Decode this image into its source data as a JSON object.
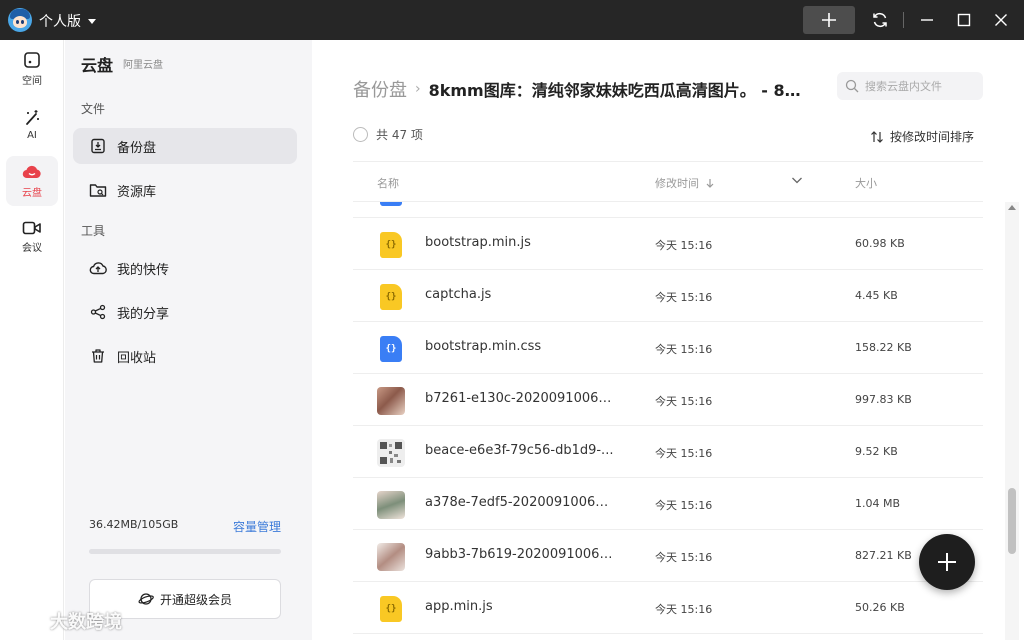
{
  "titlebar": {
    "edition_label": "个人版",
    "icons": [
      "avatar",
      "chevron-down-icon",
      "plus-icon",
      "sync-icon",
      "minimize-icon",
      "maximize-icon",
      "close-icon"
    ]
  },
  "rail": {
    "items": [
      {
        "label": "空间",
        "icon": "space-icon"
      },
      {
        "label": "AI",
        "icon": "magic-wand-icon"
      },
      {
        "label": "云盘",
        "icon": "cloud-icon"
      },
      {
        "label": "会议",
        "icon": "video-icon"
      }
    ]
  },
  "panel": {
    "title": "云盘",
    "subtitle": "阿里云盘",
    "section_files": "文件",
    "section_tools": "工具",
    "file_items": [
      {
        "label": "备份盘",
        "icon": "backup-drive-icon"
      },
      {
        "label": "资源库",
        "icon": "resource-folder-icon"
      }
    ],
    "tool_items": [
      {
        "label": "我的快传",
        "icon": "cloud-upload-icon"
      },
      {
        "label": "我的分享",
        "icon": "share-icon"
      },
      {
        "label": "回收站",
        "icon": "trash-icon"
      }
    ],
    "storage_text": "36.42MB/105GB",
    "storage_used_fraction": 0.0003,
    "storage_link": "容量管理",
    "vip_label": "开通超级会员"
  },
  "main": {
    "breadcrumb_root": "备份盘",
    "breadcrumb_current": "8kmm图库：清纯邻家妹妹吃西瓜高清图片。 - 8kmm...",
    "search_placeholder": "搜索云盘内文件",
    "count_text": "共 47 项",
    "sort_label": "按修改时间排序",
    "col_name": "名称",
    "col_time": "修改时间",
    "col_size": "大小",
    "files": [
      {
        "name": "bootstrap.min.js",
        "time": "今天 15:16",
        "size": "60.98 KB",
        "type": "js"
      },
      {
        "name": "captcha.js",
        "time": "今天 15:16",
        "size": "4.45 KB",
        "type": "js"
      },
      {
        "name": "bootstrap.min.css",
        "time": "今天 15:16",
        "size": "158.22 KB",
        "type": "css"
      },
      {
        "name": "b7261-e130c-20200910061...",
        "time": "今天 15:16",
        "size": "997.83 KB",
        "type": "photo"
      },
      {
        "name": "beace-e6e3f-79c56-db1d9-...",
        "time": "今天 15:16",
        "size": "9.52 KB",
        "type": "qr"
      },
      {
        "name": "a378e-7edf5-20200910061...",
        "time": "今天 15:16",
        "size": "1.04 MB",
        "type": "photo"
      },
      {
        "name": "9abb3-7b619-20200910061...",
        "time": "今天 15:16",
        "size": "827.21 KB",
        "type": "photo"
      },
      {
        "name": "app.min.js",
        "time": "今天 15:16",
        "size": "50.26 KB",
        "type": "js"
      }
    ]
  },
  "watermark": "大数跨境",
  "colors": {
    "accent_red": "#e8424b",
    "link_blue": "#3d7bd9",
    "js_yellow": "#f9c824",
    "css_blue": "#3a7ef5"
  }
}
